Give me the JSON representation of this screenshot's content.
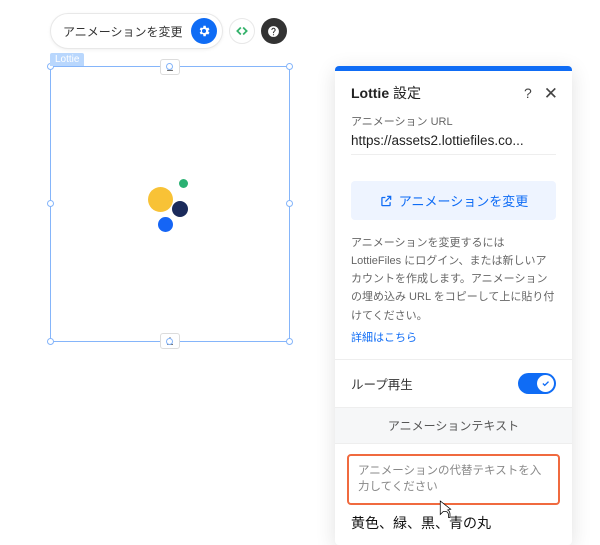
{
  "toolbar": {
    "change_label": "アニメーションを変更"
  },
  "canvas": {
    "element_tag": "Lottie"
  },
  "panel": {
    "title_prefix": "Lottie",
    "title_suffix": " 設定",
    "help_glyph": "?",
    "close_glyph": "✕",
    "url_label": "アニメーション URL",
    "url_value": "https://assets2.lottiefiles.co...",
    "change_btn": "アニメーションを変更",
    "help_text": "アニメーションを変更するには LottieFiles にログイン、または新しいアカウントを作成します。アニメーションの埋め込み URL をコピーして上に貼り付けてください。",
    "help_link": "詳細はこちら",
    "loop_label": "ループ再生",
    "text_header": "アニメーションテキスト",
    "alt_placeholder": "アニメーションの代替テキストを入力してください",
    "alt_value": "黄色、緑、黒、青の丸"
  }
}
